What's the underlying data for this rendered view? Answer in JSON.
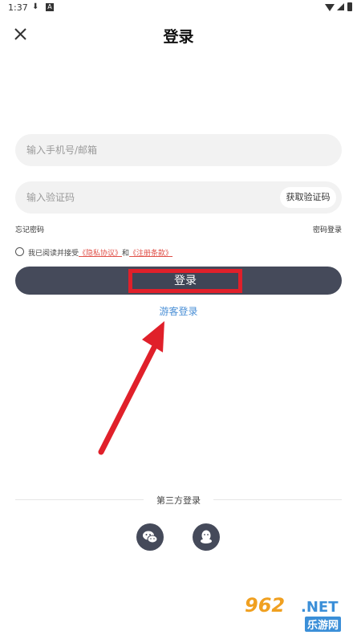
{
  "status": {
    "time": "1:37",
    "download_icon": "download-icon",
    "app_icon": "A"
  },
  "header": {
    "title": "登录",
    "close_icon": "close-icon"
  },
  "form": {
    "account_placeholder": "输入手机号/邮箱",
    "code_placeholder": "输入验证码",
    "get_code_label": "获取验证码",
    "forgot_password": "忘记密码",
    "password_login": "密码登录",
    "agree_prefix": "我已阅读并接受",
    "privacy_link": "《隐私协议》",
    "agree_and": "和",
    "terms_link": "《注册条款》",
    "login_label": "登录",
    "guest_login": "游客登录"
  },
  "third_party": {
    "label": "第三方登录",
    "items": [
      "wechat-icon",
      "qq-icon"
    ]
  },
  "watermark": {
    "number": "962",
    "domain": ".NET",
    "cn": "乐游网"
  },
  "colors": {
    "primary": "#454a5a",
    "link_red": "#e05048",
    "link_blue": "#4a8fd6",
    "highlight": "#e0202a",
    "field_bg": "#f2f2f2"
  }
}
